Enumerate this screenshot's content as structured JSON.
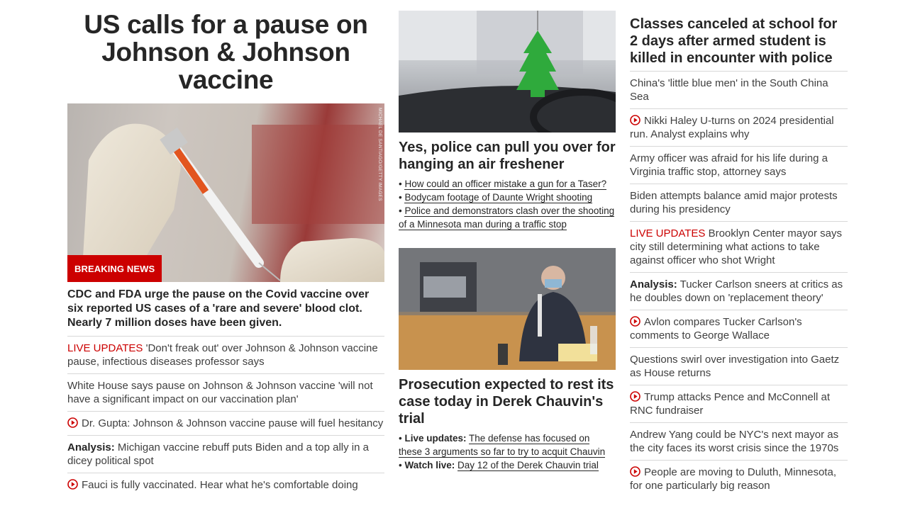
{
  "left": {
    "headline": "US calls for a pause on Johnson & Johnson vaccine",
    "badge": "BREAKING NEWS",
    "photo_credit": "MICHAEL DE SANTIAGO/GETTY IMAGES",
    "subhead": "CDC and FDA urge the pause on the Covid vaccine over six reported US cases of a 'rare and severe' blood clot. Nearly 7 million doses have been given.",
    "items": [
      {
        "kicker": "LIVE UPDATES",
        "text": "'Don't freak out' over Johnson & Johnson vaccine pause, infectious diseases professor says"
      },
      {
        "text": "White House says pause on Johnson & Johnson vaccine 'will not have a significant impact on our vaccination plan'"
      },
      {
        "text": "Dr. Gupta: Johnson & Johnson vaccine pause will fuel hesitancy"
      },
      {
        "kicker": "Analysis:",
        "text": "Michigan vaccine rebuff puts Biden and a top ally in a dicey political spot"
      },
      {
        "text": "Fauci is fully vaccinated. Hear what he's comfortable doing"
      }
    ]
  },
  "middle": {
    "story1": {
      "headline": "Yes, police can pull you over for hanging an air freshener",
      "bullets": [
        "How could an officer mistake a gun for a Taser?",
        "Bodycam footage of Daunte Wright shooting",
        "Police and demonstrators clash over the shooting of a Minnesota man during a traffic stop"
      ]
    },
    "story2": {
      "headline": "Prosecution expected to rest its case today in Derek Chauvin's trial",
      "bullets": [
        {
          "kicker": "Live updates:",
          "text": "The defense has focused on these 3 arguments so far to try to acquit Chauvin"
        },
        {
          "kicker": "Watch live:",
          "text": "Day 12 of the Derek Chauvin trial"
        }
      ]
    }
  },
  "right": {
    "headline": "Classes canceled at school for 2 days after armed student is killed in encounter with police",
    "items": [
      {
        "text": "China's 'little blue men' in the South China Sea"
      },
      {
        "text": "Nikki Haley U-turns on 2024 presidential run. Analyst explains why"
      },
      {
        "text": "Army officer was afraid for his life during a Virginia traffic stop, attorney says"
      },
      {
        "text": "Biden attempts balance amid major protests during his presidency"
      },
      {
        "kicker": "LIVE UPDATES",
        "text": "Brooklyn Center mayor says city still determining what actions to take against officer who shot Wright"
      },
      {
        "kicker": "Analysis:",
        "text": "Tucker Carlson sneers at critics as he doubles down on 'replacement theory'"
      },
      {
        "text": "Avlon compares Tucker Carlson's comments to George Wallace"
      },
      {
        "text": "Questions swirl over investigation into Gaetz as House returns"
      },
      {
        "text": "Trump attacks Pence and McConnell at RNC fundraiser"
      },
      {
        "text": "Andrew Yang could be NYC's next mayor as the city faces its worst crisis since the 1970s"
      },
      {
        "text": "People are moving to Duluth, Minnesota, for one particularly big reason"
      }
    ]
  },
  "colors": {
    "accent_red": "#cc0000",
    "text": "#262626",
    "divider": "#d8d8d8"
  },
  "icons": {
    "video": "play-circle-icon"
  }
}
